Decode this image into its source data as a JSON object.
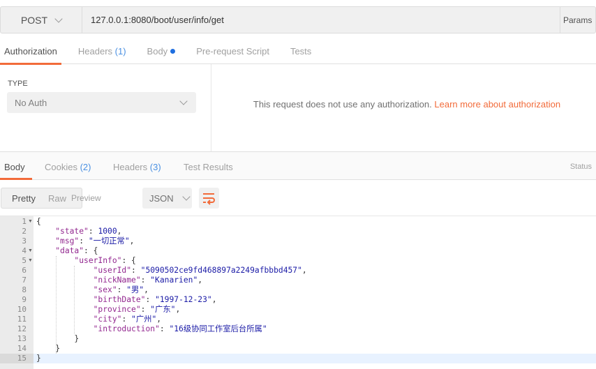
{
  "request": {
    "method": "POST",
    "url": "127.0.0.1:8080/boot/user/info/get",
    "params_label": "Params"
  },
  "request_tabs": [
    {
      "label": "Authorization",
      "active": true
    },
    {
      "label": "Headers",
      "count": "(1)"
    },
    {
      "label": "Body",
      "dot": true
    },
    {
      "label": "Pre-request Script"
    },
    {
      "label": "Tests"
    }
  ],
  "auth": {
    "type_label": "TYPE",
    "type_value": "No Auth",
    "message": "This request does not use any authorization.",
    "learn_more": "Learn more about authorization"
  },
  "response_tabs": [
    {
      "label": "Body",
      "active": true
    },
    {
      "label": "Cookies",
      "count": "(2)"
    },
    {
      "label": "Headers",
      "count": "(3)"
    },
    {
      "label": "Test Results"
    }
  ],
  "status_label": "Status",
  "view": {
    "modes": [
      "Pretty",
      "Raw",
      "Preview"
    ],
    "active": "Pretty",
    "format": "JSON",
    "wrap_icon": "wrap-lines-icon"
  },
  "colors": {
    "accent": "#f26b3a",
    "key": "#92278f",
    "string": "#1a1aa6",
    "count": "#4a90e2"
  },
  "code_lines": [
    {
      "n": "1",
      "fold": true,
      "parts": [
        [
          "p",
          "{"
        ]
      ]
    },
    {
      "n": "2",
      "parts": [
        [
          "p",
          "    "
        ],
        [
          "k",
          "\"state\""
        ],
        [
          "p",
          ": "
        ],
        [
          "n",
          "1000"
        ],
        [
          "p",
          ","
        ]
      ]
    },
    {
      "n": "3",
      "parts": [
        [
          "p",
          "    "
        ],
        [
          "k",
          "\"msg\""
        ],
        [
          "p",
          ": "
        ],
        [
          "s",
          "\"一切正常\""
        ],
        [
          "p",
          ","
        ]
      ]
    },
    {
      "n": "4",
      "fold": true,
      "parts": [
        [
          "p",
          "    "
        ],
        [
          "k",
          "\"data\""
        ],
        [
          "p",
          ": {"
        ]
      ]
    },
    {
      "n": "5",
      "fold": true,
      "parts": [
        [
          "p",
          "        "
        ],
        [
          "k",
          "\"userInfo\""
        ],
        [
          "p",
          ": {"
        ]
      ]
    },
    {
      "n": "6",
      "parts": [
        [
          "p",
          "            "
        ],
        [
          "k",
          "\"userId\""
        ],
        [
          "p",
          ": "
        ],
        [
          "s",
          "\"5090502ce9fd468897a2249afbbbd457\""
        ],
        [
          "p",
          ","
        ]
      ]
    },
    {
      "n": "7",
      "parts": [
        [
          "p",
          "            "
        ],
        [
          "k",
          "\"nickName\""
        ],
        [
          "p",
          ": "
        ],
        [
          "s",
          "\"Kanarien\""
        ],
        [
          "p",
          ","
        ]
      ]
    },
    {
      "n": "8",
      "parts": [
        [
          "p",
          "            "
        ],
        [
          "k",
          "\"sex\""
        ],
        [
          "p",
          ": "
        ],
        [
          "s",
          "\"男\""
        ],
        [
          "p",
          ","
        ]
      ]
    },
    {
      "n": "9",
      "parts": [
        [
          "p",
          "            "
        ],
        [
          "k",
          "\"birthDate\""
        ],
        [
          "p",
          ": "
        ],
        [
          "s",
          "\"1997-12-23\""
        ],
        [
          "p",
          ","
        ]
      ]
    },
    {
      "n": "10",
      "parts": [
        [
          "p",
          "            "
        ],
        [
          "k",
          "\"province\""
        ],
        [
          "p",
          ": "
        ],
        [
          "s",
          "\"广东\""
        ],
        [
          "p",
          ","
        ]
      ]
    },
    {
      "n": "11",
      "parts": [
        [
          "p",
          "            "
        ],
        [
          "k",
          "\"city\""
        ],
        [
          "p",
          ": "
        ],
        [
          "s",
          "\"广州\""
        ],
        [
          "p",
          ","
        ]
      ]
    },
    {
      "n": "12",
      "parts": [
        [
          "p",
          "            "
        ],
        [
          "k",
          "\"introduction\""
        ],
        [
          "p",
          ": "
        ],
        [
          "s",
          "\"16级协同工作室后台所属\""
        ]
      ]
    },
    {
      "n": "13",
      "parts": [
        [
          "p",
          "        }"
        ]
      ]
    },
    {
      "n": "14",
      "parts": [
        [
          "p",
          "    }"
        ]
      ]
    },
    {
      "n": "15",
      "parts": [
        [
          "p",
          "}"
        ]
      ]
    }
  ]
}
